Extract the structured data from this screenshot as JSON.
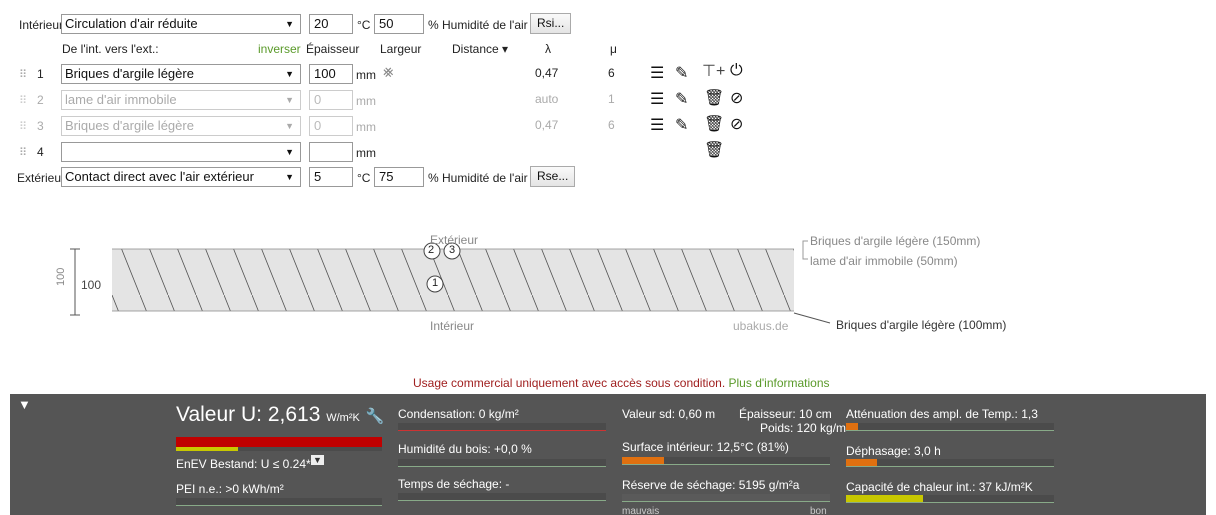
{
  "inner": {
    "label": "Intérieur",
    "condition": "Circulation d'air réduite",
    "temp": "20",
    "temp_unit": "°C",
    "humidity": "50",
    "humidity_label": "% Humidité de l'air",
    "button": "Rsi..."
  },
  "header": {
    "direction": "De l'int. vers l'ext.:",
    "invert": "inverser",
    "thickness": "Épaisseur",
    "width": "Largeur",
    "distance": "Distance ▾",
    "lambda": "λ",
    "mu": "μ"
  },
  "layers": [
    {
      "num": "1",
      "material": "Briques d'argile légère",
      "thickness": "100",
      "unit": "mm",
      "lambda": "0,47",
      "mu": "6",
      "enabled": true
    },
    {
      "num": "2",
      "material": "lame d'air immobile",
      "thickness": "0",
      "unit": "mm",
      "lambda": "auto",
      "mu": "1",
      "enabled": false
    },
    {
      "num": "3",
      "material": "Briques d'argile légère",
      "thickness": "0",
      "unit": "mm",
      "lambda": "0,47",
      "mu": "6",
      "enabled": false
    },
    {
      "num": "4",
      "material": "",
      "thickness": "",
      "unit": "mm",
      "lambda": "",
      "mu": "",
      "enabled": true
    }
  ],
  "outer": {
    "label": "Extérieur",
    "condition": "Contact direct avec l'air extérieur",
    "temp": "5",
    "temp_unit": "°C",
    "humidity": "75",
    "humidity_label": "% Humidité de l'air",
    "button": "Rse..."
  },
  "diagram": {
    "top_label": "Extérieur",
    "bottom_label": "Intérieur",
    "watermark": "ubakus.de",
    "dim_rotated": "100",
    "dim_value": "100",
    "marker1": "1",
    "marker2": "2",
    "marker3": "3",
    "legend_top1": "Briques d'argile légère (150mm)",
    "legend_top2": "lame d'air immobile (50mm)",
    "legend_bottom": "Briques d'argile légère (100mm)"
  },
  "notice": {
    "text": "Usage commercial uniquement avec accès sous condition.",
    "link": "Plus d'informations"
  },
  "results": {
    "u_label": "Valeur U:",
    "u_value": "2,613",
    "u_unit": "W/m²K",
    "enev": "EnEV Bestand: U ≤ 0.24*",
    "pei": "PEI n.e.: >0 kWh/m²",
    "condensation": "Condensation: 0 kg/m²",
    "wood_humidity": "Humidité du bois: +0,0 %",
    "drying_time": "Temps de séchage: -",
    "sd_value": "Valeur sd: 0,60 m",
    "thickness": "Épaisseur: 10 cm",
    "weight": "Poids: 120 kg/m²",
    "surface_inner": "Surface intérieur: 12,5°C (81%)",
    "drying_reserve": "Réserve de séchage: 5195 g/m²a",
    "bad": "mauvais",
    "good": "bon",
    "attenuation": "Atténuation des ampl. de Temp.: 1,3",
    "phase_shift": "Déphasage: 3,0 h",
    "heat_capacity": "Capacité de chaleur int.: 37 kJ/m²K",
    "colors": {
      "red": "#c00000",
      "orange": "#e07010",
      "yellow": "#c8c800",
      "green": "#7ab030"
    },
    "levels": {
      "u_value": 1.0,
      "enev": 0.3,
      "condensation": 0.0,
      "wood_humidity": 0.0,
      "drying_time": 0.0,
      "sd": 0.0,
      "surface_inner": 0.2,
      "drying_reserve": 1.0,
      "attenuation": 0.06,
      "phase_shift": 0.15,
      "heat_capacity": 0.37
    }
  }
}
